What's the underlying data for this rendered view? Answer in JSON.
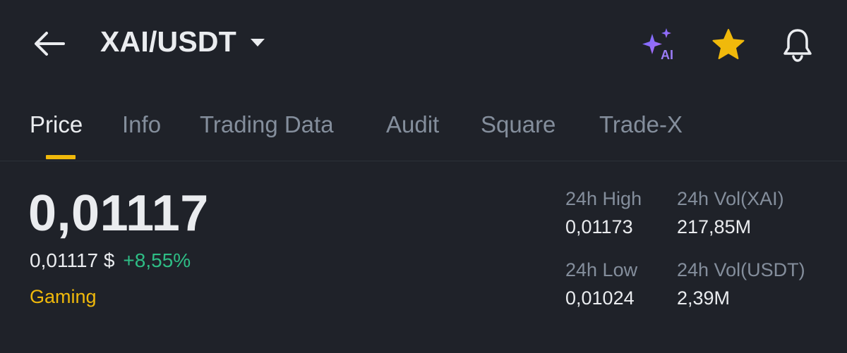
{
  "header": {
    "pair": "XAI/USDT",
    "back_icon": "arrow-left-icon",
    "dropdown_icon": "caret-down-icon",
    "ai_icon": "ai-sparkle-icon",
    "ai_badge": "AI",
    "favorite_icon": "star-icon",
    "alert_icon": "bell-icon",
    "favorite_color": "#f0b90b"
  },
  "tabs": [
    {
      "label": "Price",
      "active": true
    },
    {
      "label": "Info",
      "active": false
    },
    {
      "label": "Trading Data",
      "active": false
    },
    {
      "label": "Audit",
      "active": false
    },
    {
      "label": "Square",
      "active": false
    },
    {
      "label": "Trade-X",
      "active": false
    }
  ],
  "price": {
    "last": "0,01117",
    "fiat": "0,01117 $",
    "change": "+8,55%",
    "tag": "Gaming"
  },
  "stats": {
    "high_label": "24h High",
    "high_value": "0,01173",
    "low_label": "24h Low",
    "low_value": "0,01024",
    "vol_base_label": "24h Vol(XAI)",
    "vol_base_value": "217,85M",
    "vol_quote_label": "24h Vol(USDT)",
    "vol_quote_value": "2,39M"
  },
  "colors": {
    "background": "#1f2229",
    "accent": "#f0b90b",
    "positive": "#2ebd85",
    "text_primary": "#eaecef",
    "text_secondary": "#848e9c"
  }
}
